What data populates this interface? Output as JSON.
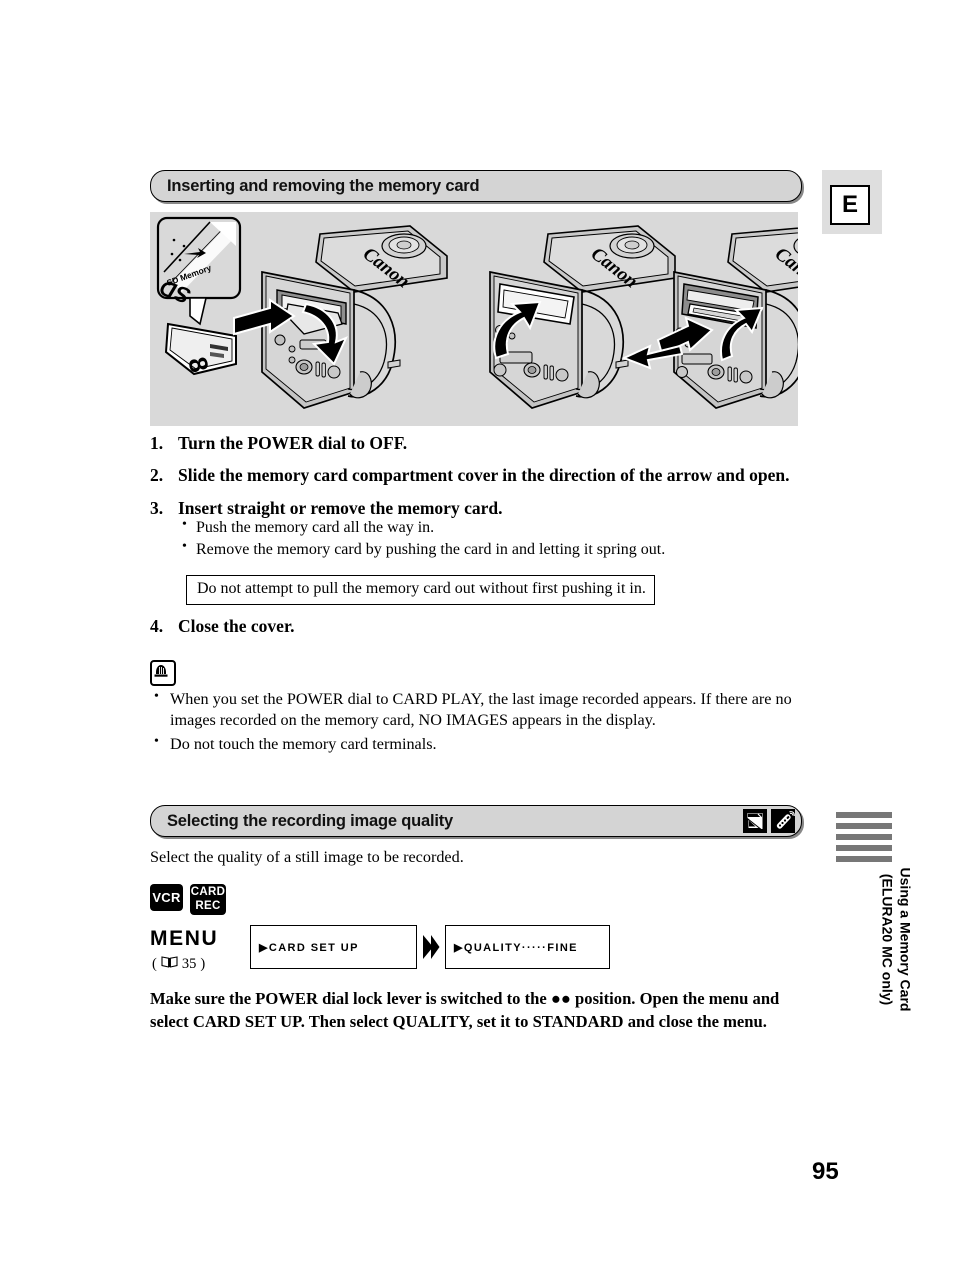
{
  "page": {
    "number": "95",
    "language_badge": "E"
  },
  "section1": {
    "title": "Inserting and removing the memory card",
    "illustration": {
      "alt_name": "camcorder-memory-card-slot-illustration",
      "brand_text": "Canon",
      "card_label": "SD Memory",
      "card_mark": "SD"
    },
    "steps": [
      {
        "num": "1.",
        "text": "Turn the POWER dial to OFF."
      },
      {
        "num": "2.",
        "text": "Slide the memory card compartment cover in the direction of the arrow and open."
      },
      {
        "num": "3.",
        "text": "Insert straight or remove the memory card."
      },
      {
        "num": "4.",
        "text": "Close the cover."
      }
    ],
    "step3_bullets": [
      "Push the memory card all the way in.",
      "Remove the memory card by pushing the card in and letting it spring out."
    ],
    "warning": "Do not attempt to pull the memory card out without first pushing it in.",
    "notes_icon": "notes-bell-icon",
    "notes": [
      "When you set the POWER dial to CARD PLAY, the last image recorded appears. If there are no images recorded on the memory card, NO IMAGES appears in the display.",
      "Do not touch the memory card terminals."
    ]
  },
  "section2": {
    "title": "Selecting the recording image quality",
    "header_icons": [
      "card-photo-icon",
      "wireless-remote-icon"
    ],
    "lead": "Select the quality of a still image to be recorded.",
    "mode_badges": [
      {
        "name": "vcr-badge",
        "lines": [
          "VCR"
        ]
      },
      {
        "name": "card-rec-badge",
        "lines": [
          "CARD",
          "REC"
        ]
      }
    ],
    "menu": {
      "label": "MENU",
      "ref_open": "(",
      "ref_icon": "book-icon",
      "ref_page": "35",
      "ref_close": ")",
      "screens": [
        {
          "name": "lcd-card-set-up",
          "text": "▶CARD SET UP"
        },
        {
          "name": "lcd-quality-fine",
          "text": "▶QUALITY·····FINE"
        }
      ],
      "arrow_icon": "double-chevron-right-icon"
    },
    "closing_parts": {
      "before": "Make sure the POWER dial lock lever is switched to the ",
      "after": " position. Open the menu and select CARD SET UP. Then select QUALITY, set it to STANDARD and close the menu.",
      "symbol": "●●"
    }
  },
  "sidebar": {
    "tab_line1": "Using a Memory Card",
    "tab_line2": "(ELURA20 MC only)",
    "bar_count": 5,
    "bar_color": "#777777"
  },
  "colors": {
    "header_fill": "#d4d4d4",
    "panel_fill": "#d9d9d9",
    "badge_panel": "#dedede",
    "ink": "#000000"
  }
}
